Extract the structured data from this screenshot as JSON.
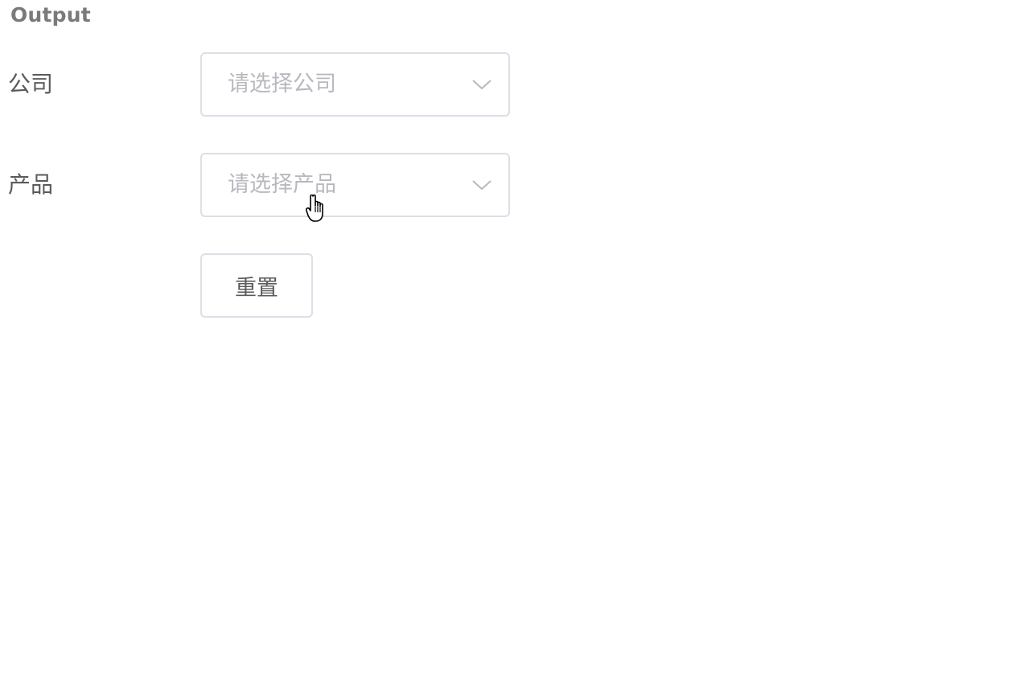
{
  "output": {
    "heading": "Output"
  },
  "form": {
    "company": {
      "label": "公司",
      "placeholder": "请选择公司",
      "icon": "chevron-down-icon"
    },
    "product": {
      "label": "产品",
      "placeholder": "请选择产品",
      "icon": "chevron-down-icon"
    },
    "reset_label": "重置"
  },
  "colors": {
    "border": "#dcdfe6",
    "placeholder": "#b8b8bf",
    "label_text": "#5a5a5a",
    "heading": "#7a7a7a"
  },
  "cursor": {
    "icon": "hand-pointer-icon"
  }
}
